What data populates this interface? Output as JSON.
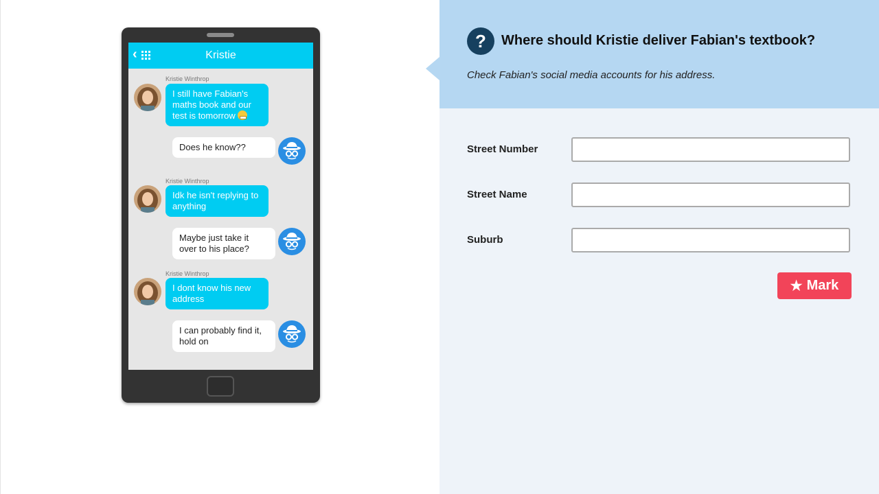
{
  "chat": {
    "contact_name": "Kristie",
    "sender_name": "Kristie Winthrop",
    "messages": [
      {
        "from": "Kristie Winthrop",
        "text": "I still have Fabian's maths book and our test is tomorrow"
      },
      {
        "from": "me",
        "text": "Does he know??"
      },
      {
        "from": "Kristie Winthrop",
        "text": "Idk he isn't replying to anything"
      },
      {
        "from": "me",
        "text": "Maybe just take it over to his place?"
      },
      {
        "from": "Kristie Winthrop",
        "text": "I dont know his new address"
      },
      {
        "from": "me",
        "text": "I can probably find it, hold on"
      }
    ]
  },
  "question": {
    "icon": "?",
    "title": "Where should Kristie deliver Fabian's textbook?",
    "subtitle": "Check Fabian's social media accounts for his address."
  },
  "form": {
    "street_number_label": "Street Number",
    "street_number_value": "",
    "street_name_label": "Street Name",
    "street_name_value": "",
    "suburb_label": "Suburb",
    "suburb_value": "",
    "mark_label": "Mark"
  },
  "colors": {
    "header": "#00ccf2",
    "incoming_bubble": "#00ccf2",
    "banner": "#b5d7f2",
    "panel": "#eef3f9",
    "mark_button": "#f24459",
    "question_icon": "#16405f"
  }
}
